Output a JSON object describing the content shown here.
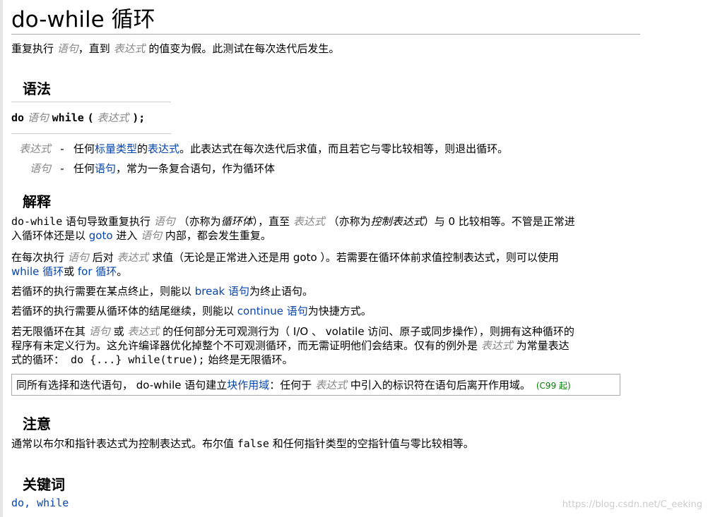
{
  "title": "do-while 循环",
  "intro": {
    "p1": "重复执行 ",
    "v1": "语句",
    "p2": "，直到 ",
    "v2": "表达式",
    "p3": " 的值变为假。此测试在每次迭代后发生。"
  },
  "sections": {
    "syntax": "语法",
    "explanation": "解释",
    "notes": "注意",
    "keywords": "关键词"
  },
  "syntax": {
    "kw_do": "do",
    "stmt": "语句",
    "kw_while": "while",
    "open": "(",
    "expr": "表达式",
    "close": ");"
  },
  "params": [
    {
      "name": "表达式",
      "dash": "-",
      "t1": "任何",
      "link1": "标量类型",
      "t2": "的",
      "link2": "表达式",
      "t3": "。此表达式在每次迭代后求值，而且若它与零比较相等，则退出循环。"
    },
    {
      "name": "语句",
      "dash": "-",
      "t1": "任何",
      "link1": "语句",
      "t2": "，常为一条复合语句，作为循环体"
    }
  ],
  "explanation": {
    "para1": {
      "code1": "do-while",
      "t1": " 语句导致重复执行 ",
      "v1": "语句",
      "t2": " （亦称为",
      "i1": "循环体",
      "t3": "），直至 ",
      "v2": "表达式",
      "t4": " （亦称为",
      "i2": "控制表达式",
      "t5": "）与 0 比较相等。不管是正常进",
      "t6": "入循环体还是以 ",
      "link1": "goto",
      "t7": " 进入 ",
      "v3": "语句",
      "t8": " 内部，都会发生重复。"
    },
    "para2": {
      "t1": "在每次执行 ",
      "v1": "语句",
      "t2": " 后对 ",
      "v2": "表达式",
      "t3": " 求值（无论是正常进入还是用 goto ）。若需要在循环体前求值控制表达式，则可以使用",
      "link1": "while 循环",
      "t4": "或 ",
      "link2": "for 循环",
      "t5": "。"
    },
    "para3": {
      "t1": "若循环的执行需要在某点终止，则能以 ",
      "link1": "break 语句",
      "t2": "为终止语句。"
    },
    "para4": {
      "t1": "若循环的执行需要从循环体的结尾继续，则能以 ",
      "link1": "continue 语句",
      "t2": "为快捷方式。"
    },
    "para5": {
      "t1": "若无限循环在其 ",
      "v1": "语句",
      "t2": " 或 ",
      "v2": "表达式",
      "t3": " 的任何部分无可观测行为（ I/O 、 volatile 访问、原子或同步操作），则拥有这种循环的",
      "t4": "程序有未定义行为。这允许编译器优化掉整个不可观测循环，而无需证明他们会结束。仅有的例外是 ",
      "v3": "表达式",
      "t5": " 为常量表达",
      "t6": "式的循环：",
      "code1": " do {...} while(true);",
      "t7": " 始终是无限循环。"
    }
  },
  "note_box": {
    "t1": "同所有选择和迭代语句， do-while 语句建立",
    "link1": "块作用域",
    "t2": "：任何于 ",
    "v1": "表达式",
    "t3": " 中引入的标识符在语句后离开作用域。",
    "badge": "(C99 起)"
  },
  "notes": {
    "t1": "通常以布尔和指针表达式为控制表达式。布尔值 ",
    "code1": "false",
    "t2": " 和任何指针类型的空指针值与零比较相等。"
  },
  "keywords": {
    "kw1": "do",
    "sep": ", ",
    "kw2": "while"
  },
  "watermark": "https://blog.csdn.net/C_eeking"
}
